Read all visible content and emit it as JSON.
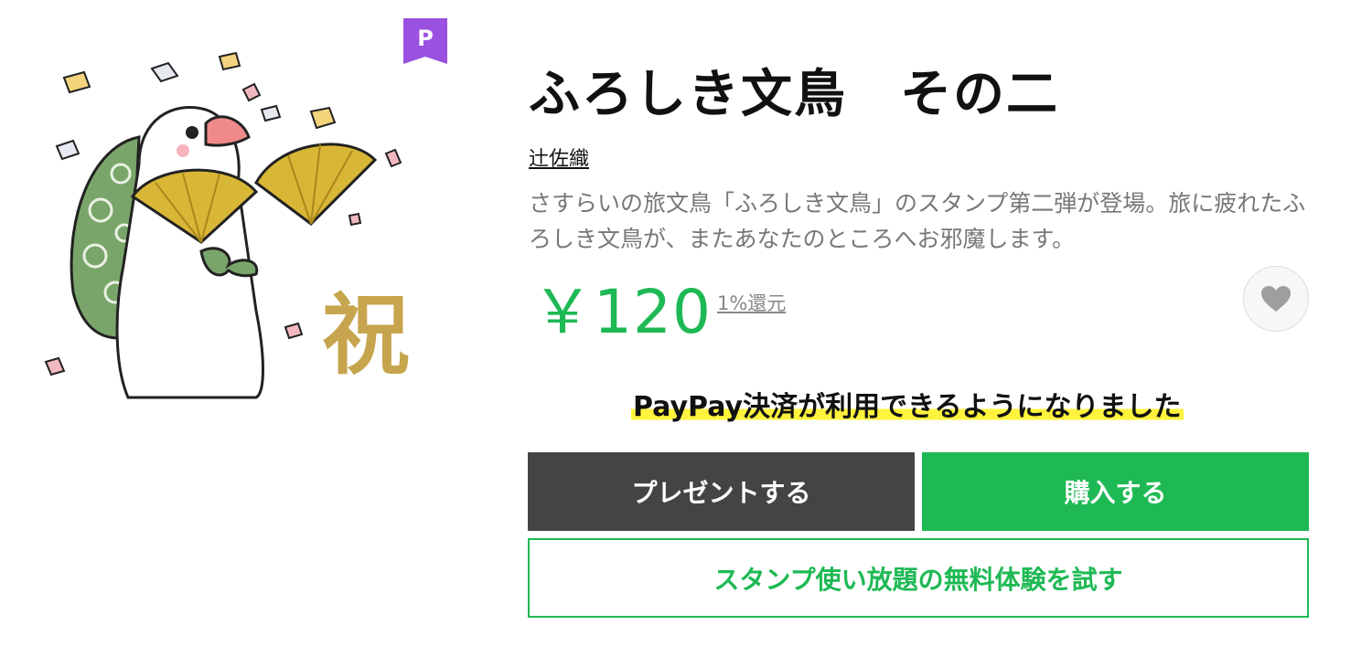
{
  "premium_badge": {
    "label": "P"
  },
  "sticker": {
    "title": "ふろしき文鳥　その二",
    "author": "辻佐織",
    "description": "さすらいの旅文鳥「ふろしき文鳥」のスタンプ第二弾が登場。旅に疲れたふろしき文鳥が、またあなたのところへお邪魔します。",
    "price": "￥120",
    "cashback": "1%還元",
    "art_glyph": "祝"
  },
  "notice": "PayPay決済が利用できるようになりました",
  "buttons": {
    "gift": "プレゼントする",
    "buy": "購入する",
    "trial": "スタンプ使い放題の無料体験を試す"
  },
  "icons": {
    "favorite": "heart-icon",
    "premium": "premium-badge-icon"
  },
  "colors": {
    "accent_green": "#1eb954",
    "gift_button": "#444444",
    "badge_purple": "#9b51e0",
    "highlight_yellow": "#fff33d"
  }
}
